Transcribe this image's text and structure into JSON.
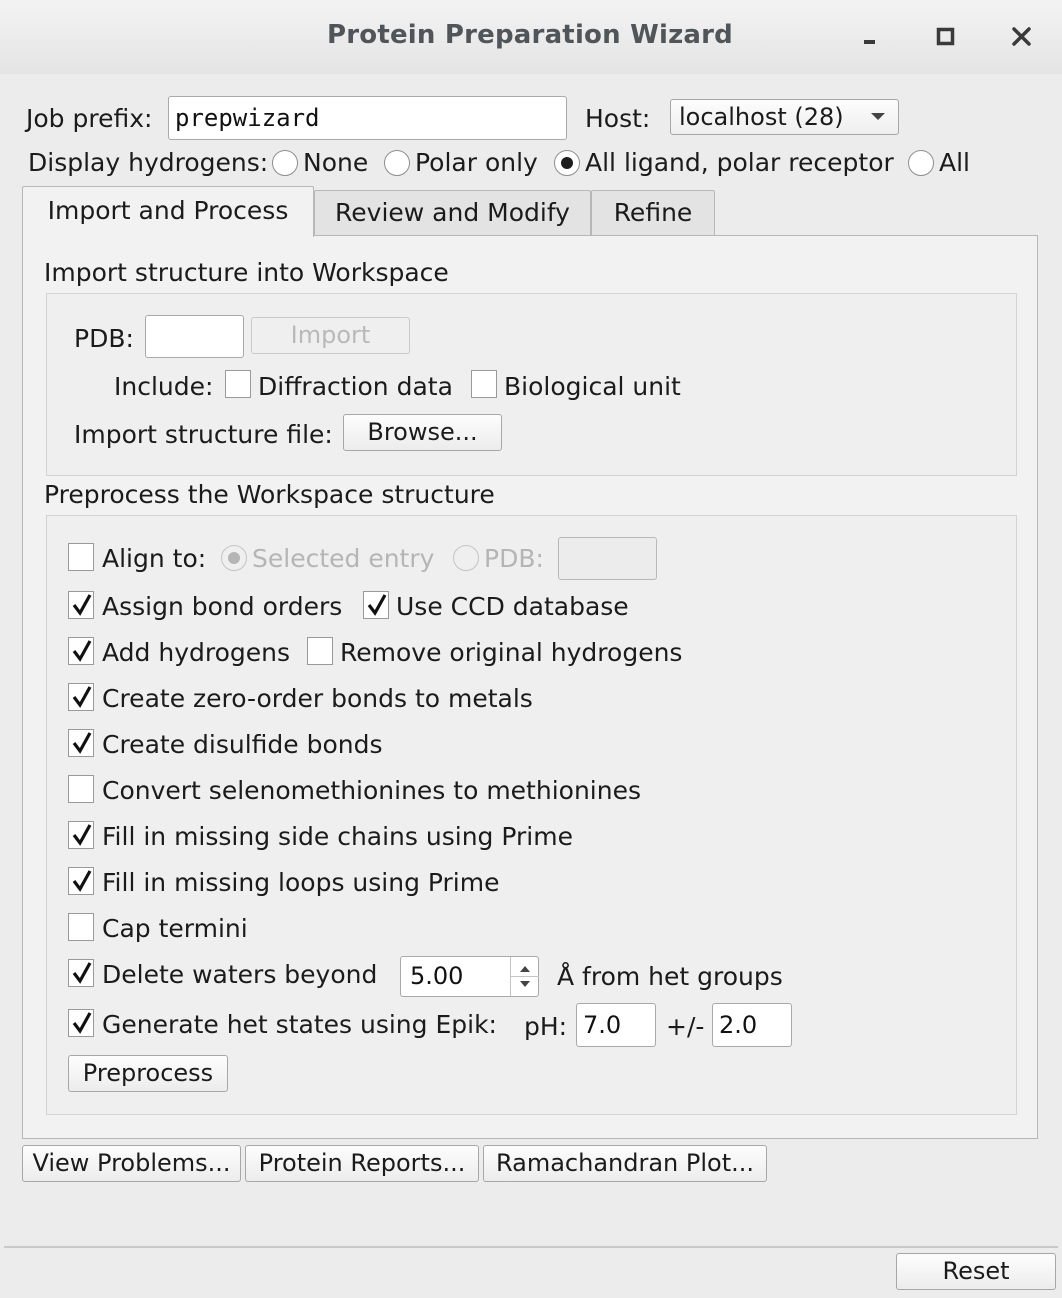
{
  "window": {
    "title": "Protein Preparation Wizard",
    "controls": [
      "minimize-icon",
      "maximize-icon",
      "close-icon"
    ]
  },
  "job": {
    "prefix_label": "Job prefix:",
    "prefix_value": "prepwizard",
    "host_label": "Host:",
    "host_value": "localhost (28)"
  },
  "hydrogens": {
    "label": "Display hydrogens:",
    "options": [
      "None",
      "Polar only",
      "All ligand, polar receptor",
      "All"
    ],
    "selected": "All ligand, polar receptor"
  },
  "tabs": [
    {
      "label": "Import and Process",
      "active": true
    },
    {
      "label": "Review and Modify",
      "active": false
    },
    {
      "label": "Refine",
      "active": false
    }
  ],
  "import_section": {
    "title": "Import structure into Workspace",
    "pdb_label": "PDB:",
    "pdb_value": "",
    "import_button": "Import",
    "include_label": "Include:",
    "diffraction_label": "Diffraction data",
    "diffraction_checked": false,
    "biological_label": "Biological unit",
    "biological_checked": false,
    "file_label": "Import structure file:",
    "browse_button": "Browse..."
  },
  "preprocess_section": {
    "title": "Preprocess the Workspace structure",
    "align_label": "Align to:",
    "align_checked": false,
    "align_selected_entry": "Selected entry",
    "align_pdb": "PDB:",
    "align_pdb_value": "",
    "options": [
      {
        "label": "Assign bond orders",
        "checked": true
      },
      {
        "label": "Use CCD database",
        "checked": true
      },
      {
        "label": "Add hydrogens",
        "checked": true
      },
      {
        "label": "Remove original hydrogens",
        "checked": false
      },
      {
        "label": "Create zero-order bonds to metals",
        "checked": true
      },
      {
        "label": "Create disulfide bonds",
        "checked": true
      },
      {
        "label": "Convert selenomethionines to methionines",
        "checked": false
      },
      {
        "label": "Fill in missing side chains using Prime",
        "checked": true
      },
      {
        "label": "Fill in missing loops using Prime",
        "checked": true
      },
      {
        "label": "Cap termini",
        "checked": false
      },
      {
        "label": "Delete waters beyond",
        "checked": true
      },
      {
        "label": "Generate het states using Epik:",
        "checked": true
      }
    ],
    "waters_value": "5.00",
    "waters_suffix": "Å from het groups",
    "ph_label": "pH:",
    "ph_value": "7.0",
    "pm_label": "+/-",
    "pm_value": "2.0",
    "preprocess_button": "Preprocess"
  },
  "bottom_buttons": {
    "view_problems": "View Problems...",
    "protein_reports": "Protein Reports...",
    "ramachandran": "Ramachandran Plot...",
    "reset": "Reset"
  }
}
